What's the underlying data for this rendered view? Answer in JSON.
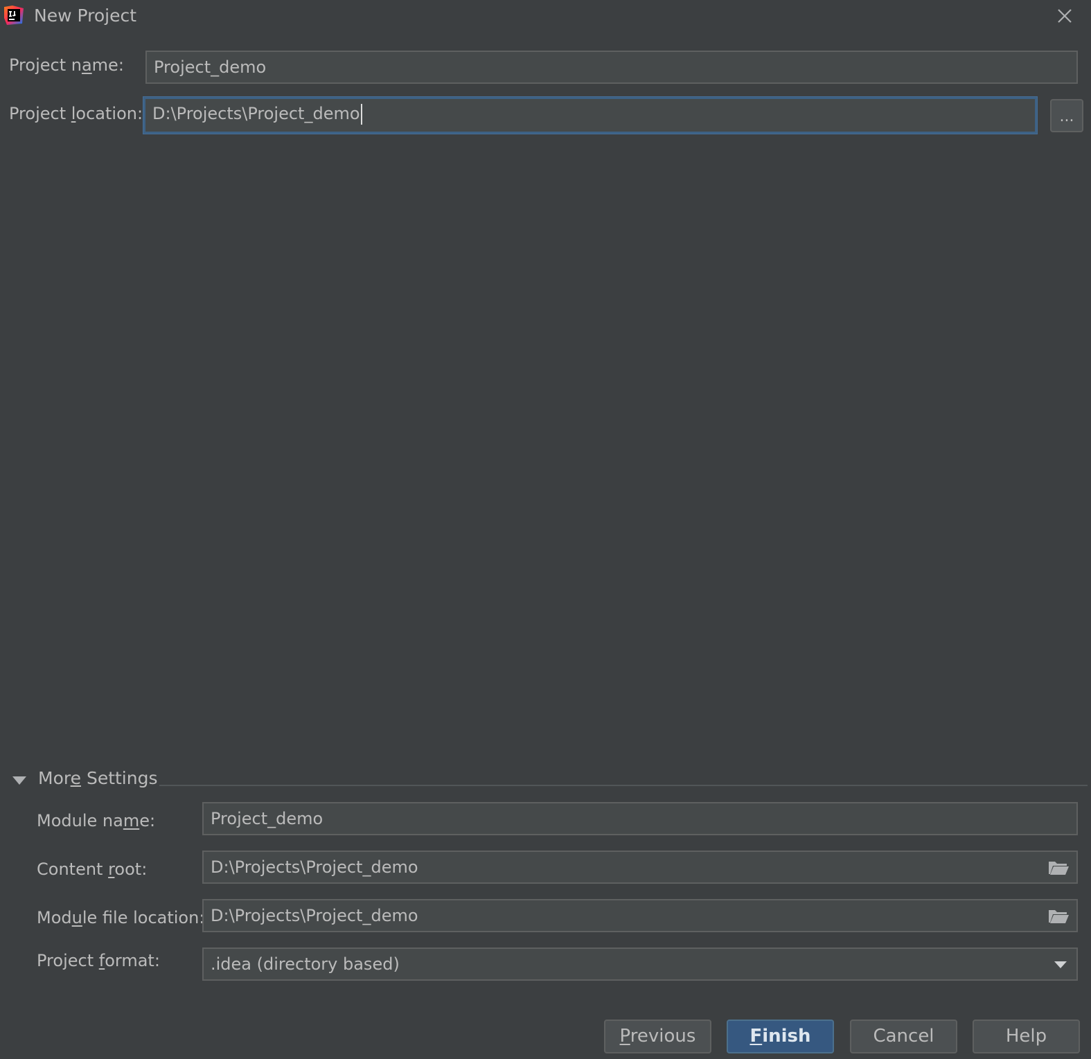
{
  "window": {
    "title": "New Project",
    "app_icon": "intellij-idea-icon",
    "close_icon": "close-icon"
  },
  "project": {
    "name_label_pre": "Project n",
    "name_label_mn": "a",
    "name_label_post": "me:",
    "name_value": "Project_demo",
    "location_label_pre": "Project ",
    "location_label_mn": "l",
    "location_label_post": "ocation:",
    "location_value": "D:\\Projects\\Project_demo",
    "browse_label": "..."
  },
  "more_settings": {
    "label_pre": "Mor",
    "label_mn": "e",
    "label_post": " Settings",
    "expanded": true,
    "module_name_label_pre": "Module na",
    "module_name_label_mn": "m",
    "module_name_label_post": "e:",
    "module_name_value": "Project_demo",
    "content_root_label_pre": "Content ",
    "content_root_label_mn": "r",
    "content_root_label_post": "oot:",
    "content_root_value": "D:\\Projects\\Project_demo",
    "module_file_label_pre": "Mod",
    "module_file_label_mn": "u",
    "module_file_label_post": "le file location:",
    "module_file_value": "D:\\Projects\\Project_demo",
    "format_label_pre": "Project ",
    "format_label_mn": "f",
    "format_label_post": "ormat:",
    "format_value": ".idea (directory based)"
  },
  "buttons": {
    "previous_mn": "P",
    "previous_rest": "revious",
    "finish_mn": "F",
    "finish_rest": "inish",
    "cancel": "Cancel",
    "help": "Help"
  },
  "colors": {
    "background": "#3c3f41",
    "field_background": "#45494a",
    "focus_border": "#3d6185",
    "primary_button": "#365880",
    "text": "#bbbbbb"
  }
}
